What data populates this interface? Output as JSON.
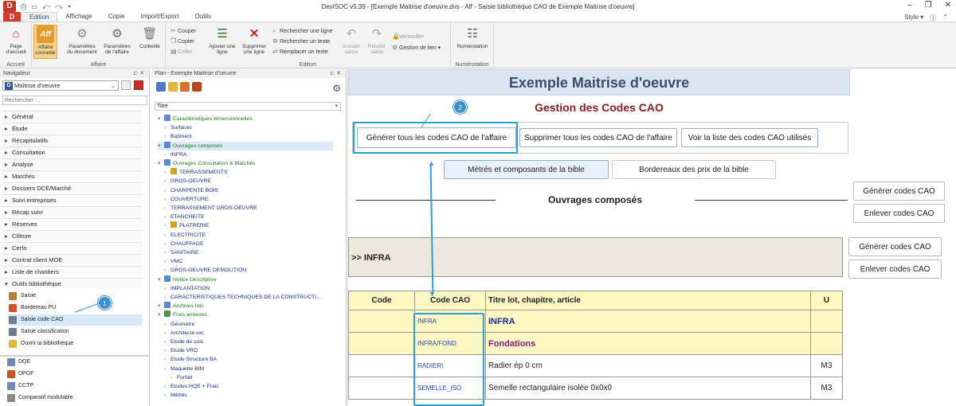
{
  "window": {
    "title": "DeviSOC v5.39 - [Exemple Maitrise d'oeuvre.dvs - Aff - Saisie bibliothèque CAO de Exemple Maitrise d'oeuvre]",
    "style_label": "Style",
    "logo_letter": "D"
  },
  "tabs": {
    "file": "D",
    "items": [
      "Edition",
      "Affichage",
      "Copie",
      "Import/Export",
      "Outils"
    ],
    "active": "Edition"
  },
  "ribbon": {
    "accueil": {
      "label": "Accueil",
      "page": "Page d'accueil"
    },
    "affaire": {
      "label": "Affaire",
      "courante": "Affaire courante",
      "icon_text": "Aff",
      "params_doc": "Paramètres du document",
      "params_aff": "Paramètres de l'affaire",
      "corbeille": "Corbeille"
    },
    "edition": {
      "label": "Edition",
      "couper": "Couper",
      "copier": "Copier",
      "coller": "Coller",
      "ajouter": "Ajouter une ligne",
      "supprimer": "Supprimer une ligne",
      "rechercher_ligne": "Rechercher une ligne",
      "rechercher_texte": "Rechercher un texte",
      "remplacer": "Remplacer un texte",
      "annuler": "Annuler saisie",
      "retablir": "Rétablir saisie",
      "verrouiller": "Verrouiller",
      "gestion_lien": "Gestion de lien"
    },
    "numerotation": {
      "label": "Numérotation",
      "btn": "Numérotation"
    }
  },
  "navigator": {
    "header": "Navigateur",
    "project": "Maîtrise d'oeuvre",
    "search_placeholder": "Rechercher ...",
    "sections": [
      "Général",
      "Étude",
      "Récapitulatifs",
      "Consultation",
      "Analyse",
      "Marchés",
      "Dossiers DCE/Marché",
      "Suivi entreprises",
      "Récap suivi",
      "Réserves",
      "Clôture",
      "Cerfa",
      "Contrat client MOE",
      "Liste de chantiers",
      "Outils bibliothèque"
    ],
    "tools": [
      "Saisie",
      "Bordereau PU",
      "Saisie code CAO",
      "Saisie classification",
      "Ouvrir la bibliothèque"
    ],
    "bottom": [
      "DQE",
      "DPGF",
      "CCTP",
      "Comparatif modulable"
    ],
    "badge": "1"
  },
  "plan": {
    "header": "Plan - Exemple Maitrise d'oeuvre",
    "column": "Titre",
    "nodes": [
      {
        "t": "Caractéristiques dimensionnelles",
        "lvl": 0,
        "cat": true
      },
      {
        "t": "Surfaces",
        "lvl": 1
      },
      {
        "t": "Batiment",
        "lvl": 1
      },
      {
        "t": "Ouvrages composés",
        "lvl": 0,
        "cat": true,
        "sel": true
      },
      {
        "t": "INFRA",
        "lvl": 1
      },
      {
        "t": "Ouvrages Consultation & Marchés",
        "lvl": 0,
        "cat": true
      },
      {
        "t": "TERRASSEMENTS",
        "lvl": 1,
        "lock": true
      },
      {
        "t": "GROS-OEUVRE",
        "lvl": 1
      },
      {
        "t": "CHARPENTE BOIS",
        "lvl": 1
      },
      {
        "t": "COUVERTURE",
        "lvl": 1
      },
      {
        "t": "TERRASSEMENT GROS-OEUVRE",
        "lvl": 1
      },
      {
        "t": "ETANCHEITE",
        "lvl": 1
      },
      {
        "t": "PLATRERIE",
        "lvl": 1,
        "lock": true
      },
      {
        "t": "ELECTRICITE",
        "lvl": 1
      },
      {
        "t": "CHAUFFAGE",
        "lvl": 1
      },
      {
        "t": "SANITAIRE",
        "lvl": 1
      },
      {
        "t": "VMC",
        "lvl": 1
      },
      {
        "t": "GROS-OEUVRE DEMOLITION",
        "lvl": 1
      },
      {
        "t": "Notice Descriptive",
        "lvl": 0,
        "cat": true
      },
      {
        "t": "IMPLANTATION",
        "lvl": 1
      },
      {
        "t": "CARACTERISTIQUES TECHNIQUES DE LA CONSTRUCTI...",
        "lvl": 1
      },
      {
        "t": "Archives lots",
        "lvl": 0,
        "cat": true
      },
      {
        "t": "Frais annexes",
        "lvl": 0,
        "cat": true
      },
      {
        "t": "Géomètre",
        "lvl": 1
      },
      {
        "t": "Architecte ext.",
        "lvl": 1
      },
      {
        "t": "Etude de sols",
        "lvl": 1
      },
      {
        "t": "Etude VRD",
        "lvl": 1
      },
      {
        "t": "Etude Structure BA",
        "lvl": 1
      },
      {
        "t": "Maquette BIM",
        "lvl": 1
      },
      {
        "t": "Forfait",
        "lvl": 2
      },
      {
        "t": "Etudes HQE + Frais",
        "lvl": 1
      },
      {
        "t": "Métrés",
        "lvl": 1
      }
    ]
  },
  "sheet": {
    "title": "Exemple Maitrise d'oeuvre",
    "subtitle": "Gestion des Codes CAO",
    "btn_generate_all": "Générer tous les codes CAO de l'affaire",
    "btn_delete_all": "Supprimer tous les codes CAO de l'affaire",
    "btn_list": "Voir la liste des codes CAO utilisés",
    "btn_metres": "Métrés et composants de la bible",
    "btn_bordereaux": "Bordereaux des prix de la bible",
    "section_title": "Ouvrages composés",
    "btn_gen_codes": "Générer codes CAO",
    "btn_rem_codes": "Enlever codes CAO",
    "infra_label": ">>   INFRA",
    "badge": "2",
    "table": {
      "headers": [
        "Code",
        "Code CAO",
        "Titre lot, chapitre, article",
        "U"
      ],
      "rows": [
        {
          "code": "",
          "cao": "INFRA",
          "titre": "INFRA",
          "u": "",
          "style": "blue"
        },
        {
          "code": "",
          "cao": "INFRA/FOND",
          "titre": "Fondations",
          "u": "",
          "style": "purple"
        },
        {
          "code": "",
          "cao": "RADIER\\",
          "titre": "Radier ép 0 cm",
          "u": "M3",
          "style": "plain"
        },
        {
          "code": "",
          "cao": "SEMELLE_ISO",
          "titre": "Semelle rectangulaire isolée 0x0x0",
          "u": "M3",
          "style": "plain"
        }
      ]
    }
  },
  "colors": {
    "accent": "#2a9fd6",
    "header_blue": "#dbe5f1",
    "yellow": "#fdf7c3",
    "subtitle": "#8b1a1a"
  }
}
